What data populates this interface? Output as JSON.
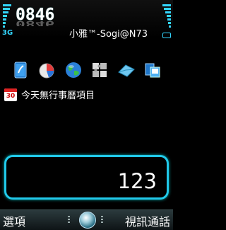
{
  "status": {
    "time": "0846",
    "network": "3G",
    "operator": "小雅™-Sogi@N73",
    "accent": "#33d6ff"
  },
  "shortcuts": [
    {
      "name": "phone-book-icon"
    },
    {
      "name": "pie-chart-icon"
    },
    {
      "name": "globe-icon"
    },
    {
      "name": "puzzle-icon"
    },
    {
      "name": "messaging-icon"
    },
    {
      "name": "gallery-icon"
    }
  ],
  "calendar": {
    "day": "30",
    "text": "今天無行事曆項目"
  },
  "dialer": {
    "value": "123"
  },
  "softkeys": {
    "left": "選項",
    "right": "視訊通話"
  }
}
